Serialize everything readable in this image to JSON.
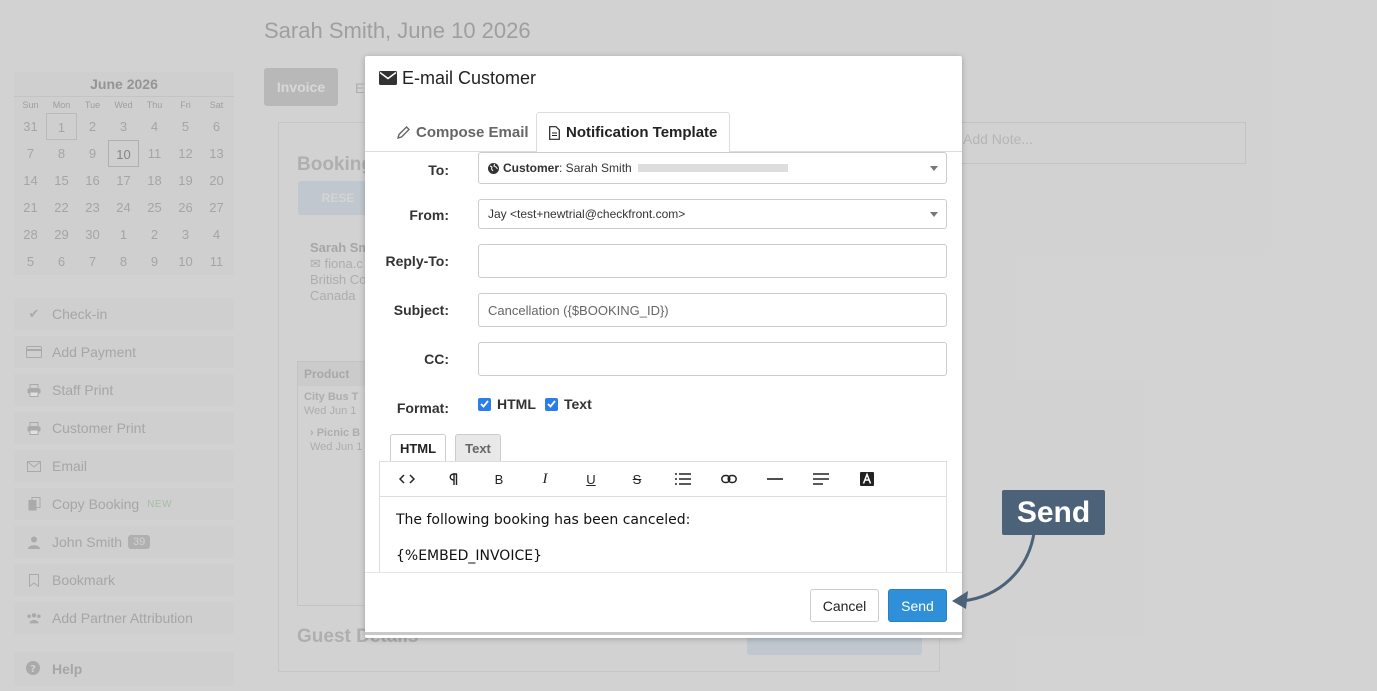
{
  "page": {
    "title": "Sarah Smith, June 10 2026",
    "tabs": {
      "invoice": "Invoice",
      "second": "E"
    },
    "note_placeholder": "Add Note...",
    "booking_heading": "Booking",
    "reserve_btn": "RESE",
    "guest_heading": "Guest Details",
    "customer": {
      "name": "Sarah Sm",
      "email": "fiona.c",
      "region": "British Co",
      "country": "Canada"
    },
    "table": {
      "header": "Product",
      "row1_title": "City Bus T",
      "row1_date": "Wed Jun 1",
      "row2_title": "› Picnic B",
      "row2_date": "Wed Jun 1"
    }
  },
  "calendar": {
    "title": "June 2026",
    "days_of_week": [
      "Sun",
      "Mon",
      "Tue",
      "Wed",
      "Thu",
      "Fri",
      "Sat"
    ],
    "days": [
      "31",
      "1",
      "2",
      "3",
      "4",
      "5",
      "6",
      "7",
      "8",
      "9",
      "10",
      "11",
      "12",
      "13",
      "14",
      "15",
      "16",
      "17",
      "18",
      "19",
      "20",
      "21",
      "22",
      "23",
      "24",
      "25",
      "26",
      "27",
      "28",
      "29",
      "30",
      "1",
      "2",
      "3",
      "4",
      "5",
      "6",
      "7",
      "8",
      "9",
      "10",
      "11"
    ]
  },
  "sidebar": {
    "items": [
      {
        "label": "Check-in",
        "icon": "check-icon"
      },
      {
        "label": "Add Payment",
        "icon": "credit-card-icon"
      },
      {
        "label": "Staff Print",
        "icon": "printer-icon"
      },
      {
        "label": "Customer Print",
        "icon": "printer-icon"
      },
      {
        "label": "Email",
        "icon": "envelope-icon"
      },
      {
        "label": "Copy Booking",
        "icon": "copy-icon",
        "badge": "NEW"
      },
      {
        "label": "John Smith",
        "icon": "user-icon",
        "count": "39"
      },
      {
        "label": "Bookmark",
        "icon": "bookmark-icon"
      },
      {
        "label": "Add Partner Attribution",
        "icon": "users-icon"
      }
    ],
    "help": "Help"
  },
  "modal": {
    "title": "E-mail Customer",
    "tabs": {
      "compose": "Compose Email",
      "template": "Notification Template"
    },
    "fields": {
      "to": {
        "label": "To:",
        "prefix": "Customer",
        "value": ": Sarah Smith"
      },
      "from": {
        "label": "From:",
        "value": "Jay <test+newtrial@checkfront.com>"
      },
      "reply_to": {
        "label": "Reply-To:",
        "value": ""
      },
      "subject": {
        "label": "Subject:",
        "value": "Cancellation ({$BOOKING_ID})"
      },
      "cc": {
        "label": "CC:",
        "value": ""
      },
      "format": {
        "label": "Format:",
        "html": "HTML",
        "text": "Text"
      }
    },
    "editor": {
      "tabs": {
        "html": "HTML",
        "text": "Text"
      },
      "toolbar": [
        "code-icon",
        "paragraph-icon",
        "bold-icon",
        "italic-icon",
        "underline-icon",
        "strikethrough-icon",
        "list-icon",
        "link-icon",
        "horizontal-rule-icon",
        "align-icon",
        "text-color-icon"
      ],
      "line1": "The following booking has been canceled:",
      "line2": "{%EMBED_INVOICE}"
    },
    "buttons": {
      "cancel": "Cancel",
      "send": "Send"
    }
  },
  "callout": {
    "label": "Send"
  },
  "colors": {
    "accent": "#2f8fd8",
    "callout": "#4b6278",
    "checkbox": "#2b7de9"
  }
}
